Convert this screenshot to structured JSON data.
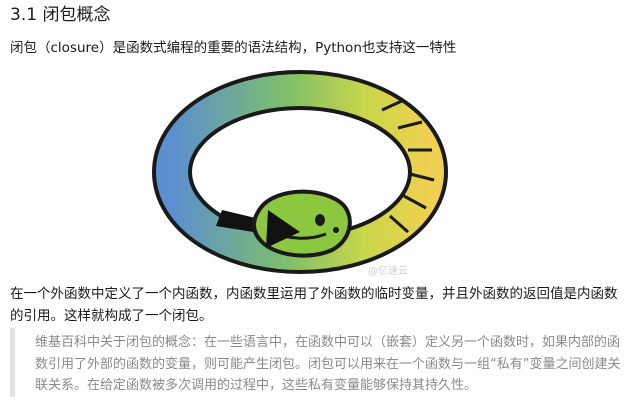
{
  "heading": "3.1 闭包概念",
  "intro": "闭包（closure）是函数式编程的重要的语法结构，Python也支持这一特性",
  "watermark": "@亿速云",
  "body_text": "在一个外函数中定义了一个内函数，内函数里运用了外函数的临时变量，并且外函数的返回值是内函数的引用。这样就构成了一个闭包。",
  "quote_text": "维基百科中关于闭包的概念：在一些语言中，在函数中可以（嵌套）定义另一个函数时，如果内部的函数引用了外部的函数的变量，则可能产生闭包。闭包可以用来在一个函数与一组“私有”变量之间创建关联关系。在给定函数被多次调用的过程中，这些私有变量能够保持其持久性。",
  "colors": {
    "ring_blue": "#5b8fd0",
    "ring_green": "#8dc63f",
    "ring_yellow": "#f0d050",
    "snake_head": "#8dc63f",
    "arrow": "#111111",
    "quote_border": "#e3e3e3",
    "quote_text": "#8a8a8a"
  },
  "illustration": "ouroboros-snake-icon"
}
